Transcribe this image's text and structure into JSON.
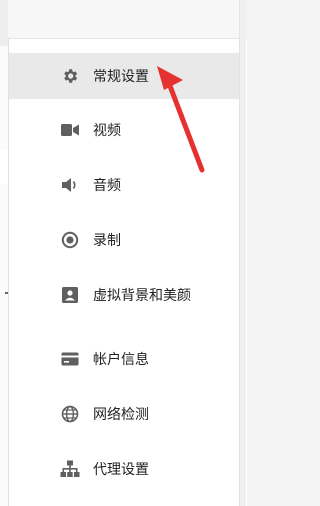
{
  "colors": {
    "icon": "#5f5f5f",
    "active_bg": "#e9e9e9",
    "annotation_arrow": "#e5312f"
  },
  "menu": {
    "items": [
      {
        "label": "常规设置",
        "icon": "gear-icon",
        "active": true
      },
      {
        "label": "视频",
        "icon": "video-camera-icon"
      },
      {
        "label": "音频",
        "icon": "speaker-icon"
      },
      {
        "label": "录制",
        "icon": "record-icon"
      },
      {
        "label": "虚拟背景和美颜",
        "icon": "portrait-icon"
      },
      {
        "label": "帐户信息",
        "icon": "card-icon"
      },
      {
        "label": "网络检测",
        "icon": "globe-icon"
      },
      {
        "label": "代理设置",
        "icon": "network-tree-icon"
      }
    ]
  }
}
